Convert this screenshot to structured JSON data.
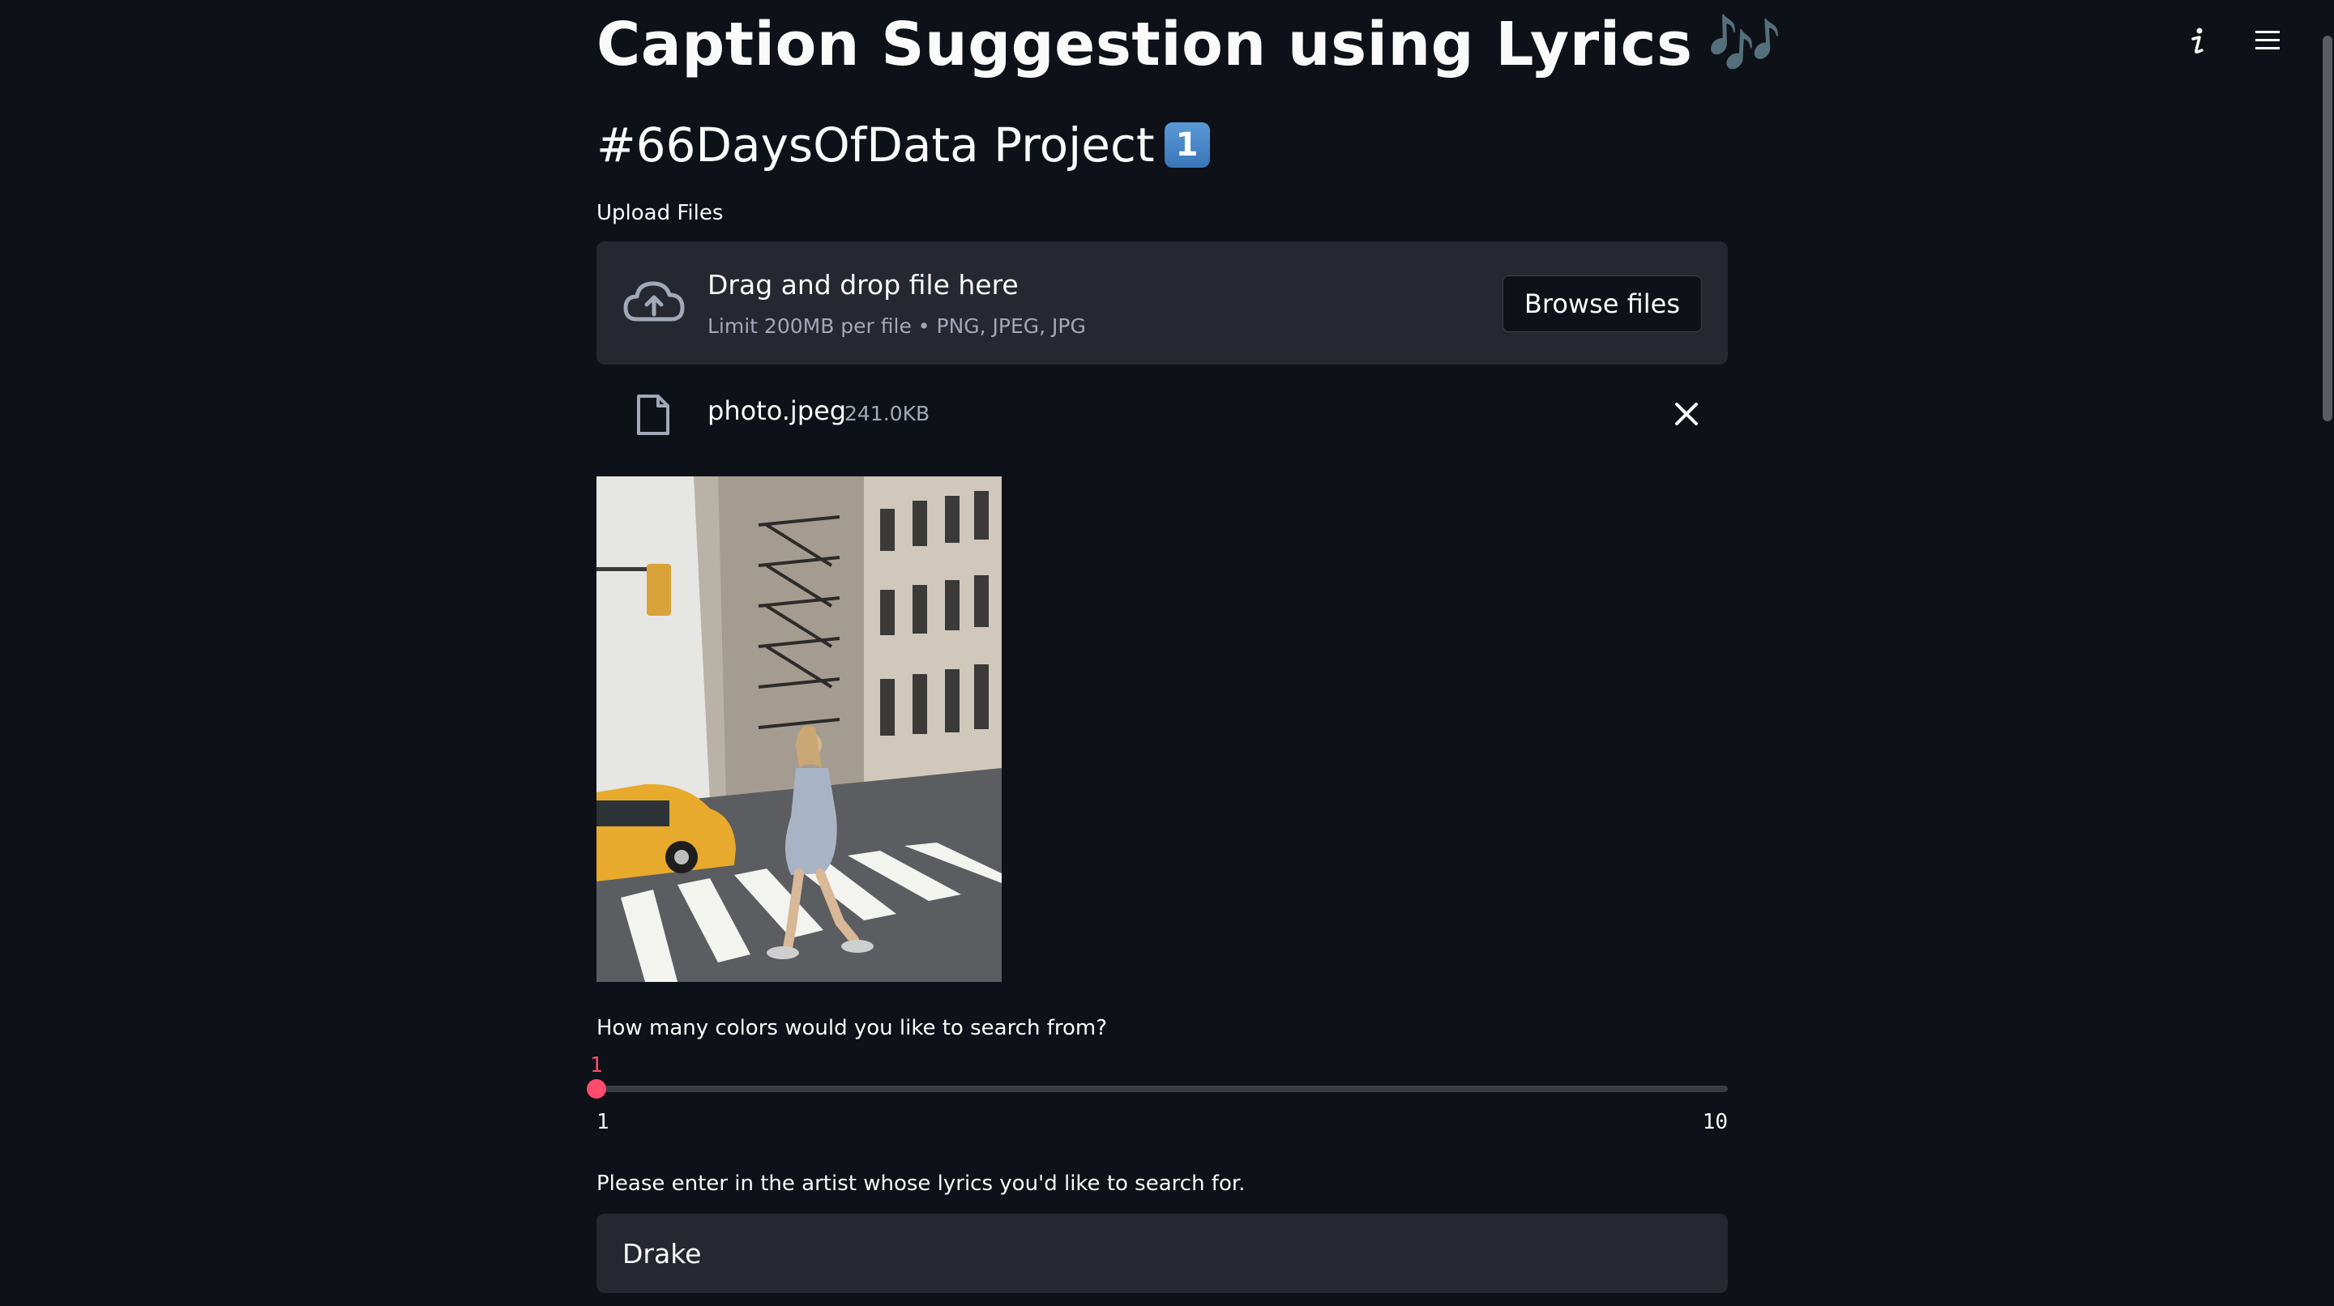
{
  "app": {
    "title": "Caption Suggestion using Lyrics",
    "title_emoji": "🎶",
    "subtitle": "#66DaysOfData Project",
    "subtitle_keycap": "1",
    "accent_color": "#ff4b6e",
    "background_color": "#0e1117"
  },
  "toolbar": {
    "about_icon": "info-icon",
    "menu_icon": "hamburger-menu-icon"
  },
  "uploader": {
    "label": "Upload Files",
    "dropzone_title": "Drag and drop file here",
    "dropzone_limit": "Limit 200MB per file • PNG, JPEG, JPG",
    "browse_label": "Browse files",
    "file": {
      "name": "photo.jpeg",
      "size": "241.0KB"
    }
  },
  "colors_slider": {
    "label": "How many colors would you like to search from?",
    "value": "1",
    "min": "1",
    "max": "10",
    "fraction": 0
  },
  "artist_input": {
    "label": "Please enter in the artist whose lyrics you'd like to search for.",
    "value": "Drake"
  }
}
